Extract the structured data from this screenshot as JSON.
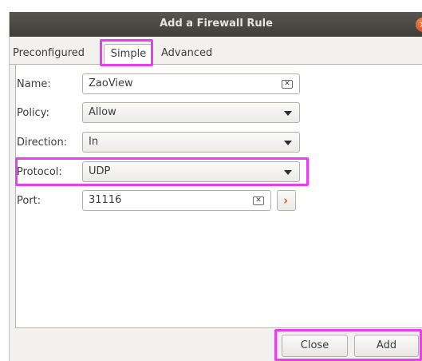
{
  "window": {
    "title": "Add a Firewall Rule"
  },
  "tabs": [
    {
      "label": "Preconfigured"
    },
    {
      "label": "Simple"
    },
    {
      "label": "Advanced"
    }
  ],
  "form": {
    "name": {
      "label": "Name:",
      "value": "ZaoView"
    },
    "policy": {
      "label": "Policy:",
      "value": "Allow"
    },
    "direction": {
      "label": "Direction:",
      "value": "In"
    },
    "protocol": {
      "label": "Protocol:",
      "value": "UDP"
    },
    "port": {
      "label": "Port:",
      "value": "31116"
    }
  },
  "buttons": {
    "close": "Close",
    "add": "Add"
  },
  "colors": {
    "highlight": "#e83ef0",
    "titlebar": "#4a4944",
    "accent": "#e2581c"
  }
}
